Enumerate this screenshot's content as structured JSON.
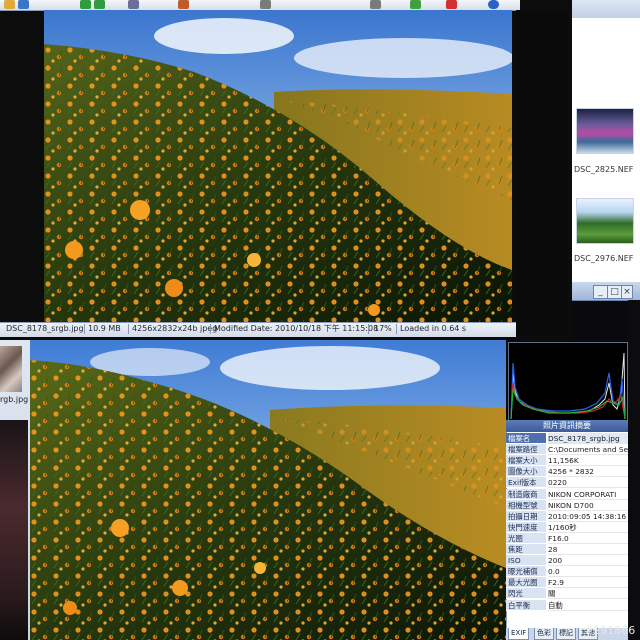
{
  "top_window": {
    "status": {
      "filename": "DSC_8178_srgb.jpg",
      "filesize": "10.9 MB",
      "dimensions": "4256x2832x24b jpeg",
      "modified": "Modified Date: 2010/10/18 下午 11:15:08",
      "zoom": "17%",
      "loaded": "Loaded in 0.64 s"
    },
    "toolbar_icons": [
      "folder-icon",
      "save-icon",
      "back-icon",
      "forward-icon",
      "zoom-icon",
      "rotate-icon",
      "edit-icon",
      "settings-icon",
      "delete-icon",
      "check-icon",
      "help-icon"
    ]
  },
  "file_browser": {
    "thumbnails": [
      {
        "label": "DSC_2825.NEF"
      },
      {
        "label": "DSC_2976.NEF"
      }
    ]
  },
  "left_panel": {
    "thumb_label": "rgb.jpg"
  },
  "info_panel": {
    "title": "照片資訊摘要",
    "rows": [
      {
        "key": "檔案名",
        "value": "DSC_8178_srgb.jpg"
      },
      {
        "key": "檔案路徑",
        "value": "C:\\Documents and Set"
      },
      {
        "key": "檔案大小",
        "value": "11,156K"
      },
      {
        "key": "圖像大小",
        "value": "4256 * 2832"
      },
      {
        "key": "Exif版本",
        "value": "0220"
      },
      {
        "key": "制造廠商",
        "value": "NIKON CORPORATI"
      },
      {
        "key": "相機型號",
        "value": "NIKON D700"
      },
      {
        "key": "拍攝日期",
        "value": "2010:09:05 14:38:16"
      },
      {
        "key": "快門速度",
        "value": "1/160秒"
      },
      {
        "key": "光圈",
        "value": "F16.0"
      },
      {
        "key": "焦距",
        "value": "28"
      },
      {
        "key": "ISO",
        "value": "200"
      },
      {
        "key": "曝光補償",
        "value": "0.0"
      },
      {
        "key": "最大光圈",
        "value": "F2.9"
      },
      {
        "key": "閃光",
        "value": "關"
      },
      {
        "key": "白平衡",
        "value": "自動"
      }
    ],
    "tabs": [
      "EXIF",
      "色彩",
      "標記",
      "其他"
    ]
  },
  "watermark": "#291866",
  "colors": {
    "sky": "#5b8fd6",
    "lily_orange": "#f0941e",
    "panel_blue": "#4f6fae"
  }
}
